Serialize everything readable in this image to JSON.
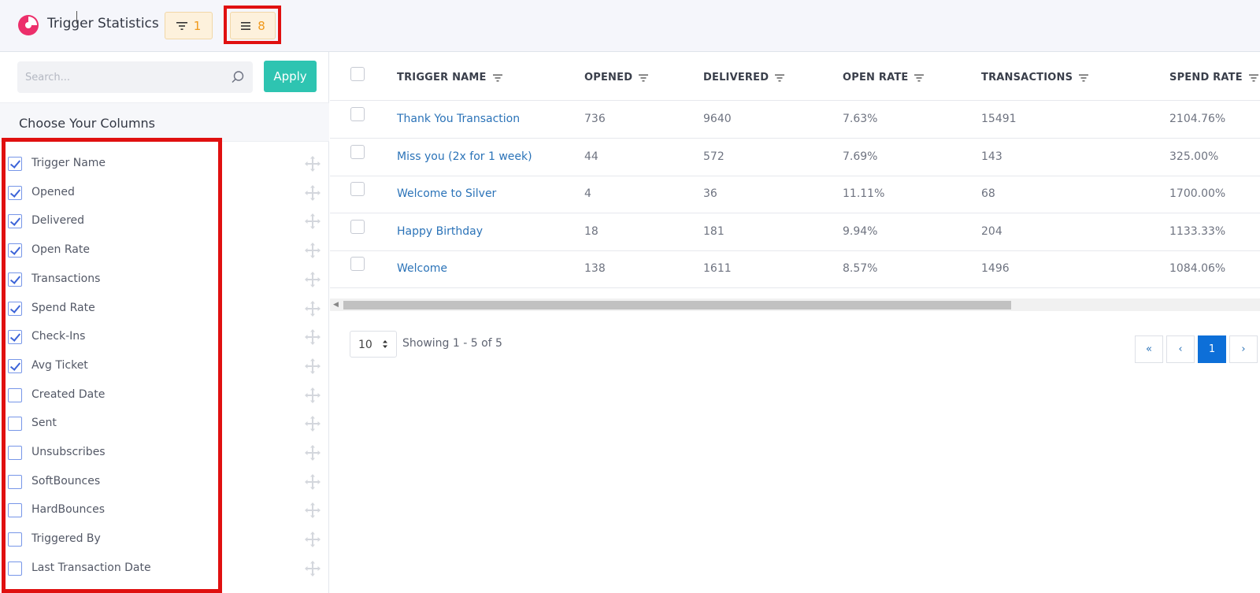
{
  "header": {
    "title": "Trigger Statistics",
    "filter_count": "1",
    "columns_count": "8"
  },
  "sidebar": {
    "search_placeholder": "Search...",
    "apply_label": "Apply",
    "choose_title": "Choose Your Columns",
    "columns": [
      {
        "label": "Trigger Name",
        "checked": true
      },
      {
        "label": "Opened",
        "checked": true
      },
      {
        "label": "Delivered",
        "checked": true
      },
      {
        "label": "Open Rate",
        "checked": true
      },
      {
        "label": "Transactions",
        "checked": true
      },
      {
        "label": "Spend Rate",
        "checked": true
      },
      {
        "label": "Check-Ins",
        "checked": true
      },
      {
        "label": "Avg Ticket",
        "checked": true
      },
      {
        "label": "Created Date",
        "checked": false
      },
      {
        "label": "Sent",
        "checked": false
      },
      {
        "label": "Unsubscribes",
        "checked": false
      },
      {
        "label": "SoftBounces",
        "checked": false
      },
      {
        "label": "HardBounces",
        "checked": false
      },
      {
        "label": "Triggered By",
        "checked": false
      },
      {
        "label": "Last Transaction Date",
        "checked": false
      }
    ]
  },
  "table": {
    "headers": [
      "TRIGGER NAME",
      "OPENED",
      "DELIVERED",
      "OPEN RATE",
      "TRANSACTIONS",
      "SPEND RATE"
    ],
    "rows": [
      [
        "Thank You Transaction",
        "736",
        "9640",
        "7.63%",
        "15491",
        "2104.76%"
      ],
      [
        "Miss you (2x for 1 week)",
        "44",
        "572",
        "7.69%",
        "143",
        "325.00%"
      ],
      [
        "Welcome to Silver",
        "4",
        "36",
        "11.11%",
        "68",
        "1700.00%"
      ],
      [
        "Happy Birthday",
        "18",
        "181",
        "9.94%",
        "204",
        "1133.33%"
      ],
      [
        "Welcome",
        "138",
        "1611",
        "8.57%",
        "1496",
        "1084.06%"
      ]
    ]
  },
  "pagination": {
    "page_size": "10",
    "showing": "Showing 1 - 5 of 5",
    "first": "«",
    "prev": "‹",
    "current": "1",
    "next": "›"
  },
  "colors": {
    "accent": "#2ec4b1",
    "link": "#2b73b8",
    "highlight": "#e01010",
    "chip_bg": "#fdf1dc",
    "chip_text": "#f0981a",
    "page_active": "#0d6fd8"
  },
  "icons": {
    "logo": "pie-chart-icon",
    "filter": "filter-icon",
    "columns": "list-icon",
    "search": "search-icon",
    "drag": "drag-move-icon",
    "sort": "sort-filter-icon"
  }
}
